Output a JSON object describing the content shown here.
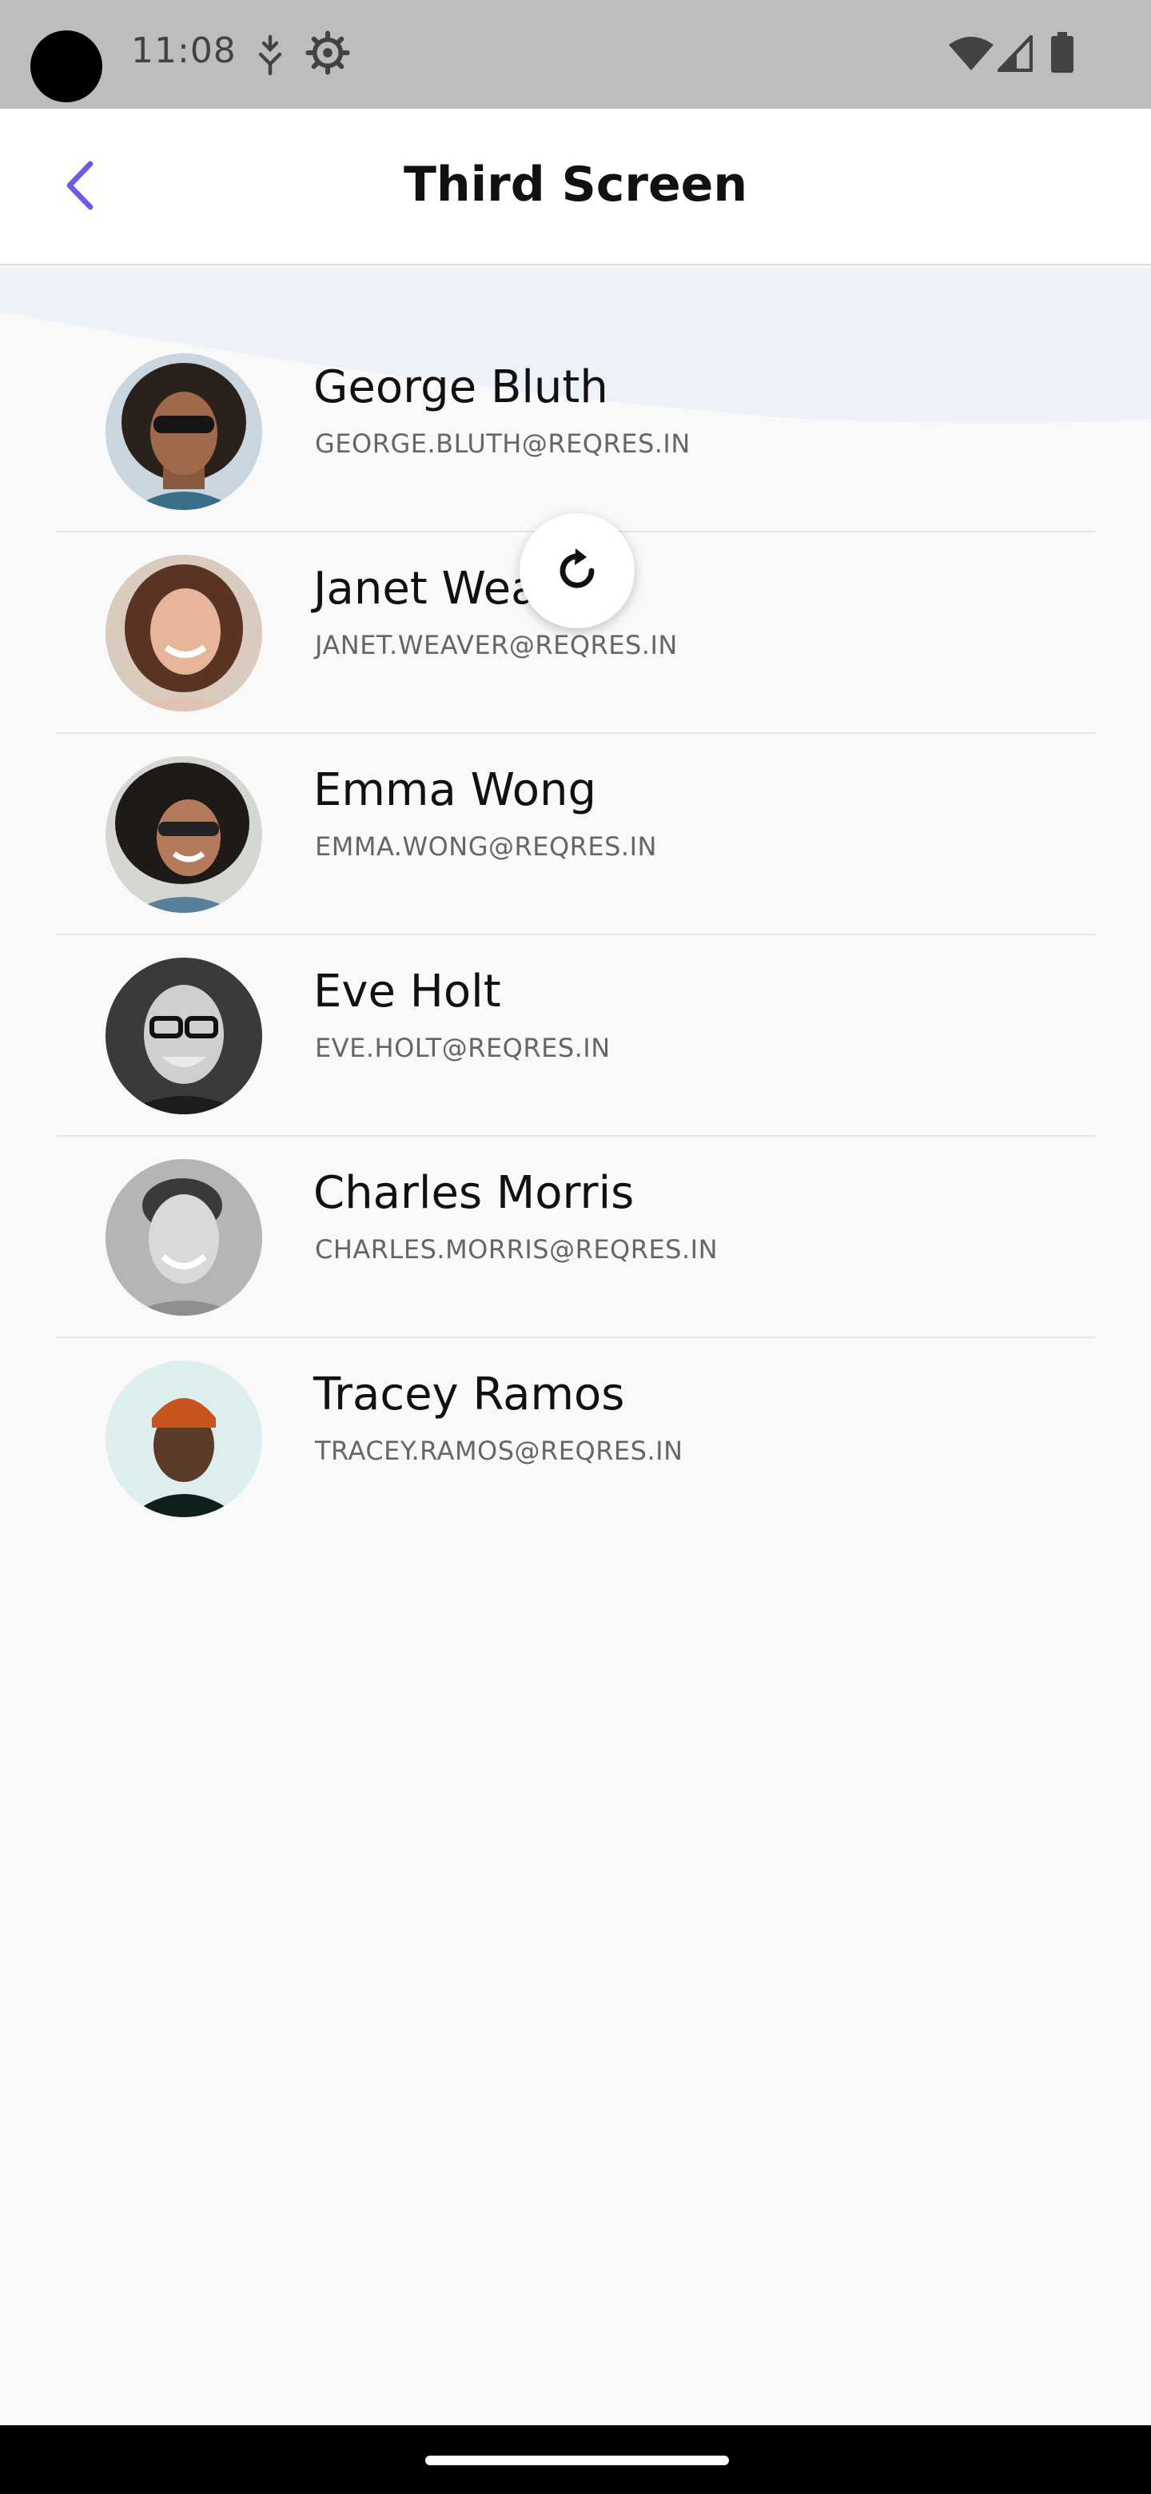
{
  "status_bar": {
    "time": "11:08",
    "icons": [
      "data-saver-icon",
      "settings-gear-icon",
      "wifi-icon",
      "cell-signal-icon",
      "battery-icon"
    ]
  },
  "app_bar": {
    "title": "Third Screen",
    "back_icon": "chevron-left-icon",
    "accent_color": "#6b5ce7"
  },
  "users": [
    {
      "name": "George Bluth",
      "email": "GEORGE.BLUTH@REQRES.IN"
    },
    {
      "name": "Janet Weaver",
      "email": "JANET.WEAVER@REQRES.IN"
    },
    {
      "name": "Emma Wong",
      "email": "EMMA.WONG@REQRES.IN"
    },
    {
      "name": "Eve Holt",
      "email": "EVE.HOLT@REQRES.IN"
    },
    {
      "name": "Charles Morris",
      "email": "CHARLES.MORRIS@REQRES.IN"
    },
    {
      "name": "Tracey Ramos",
      "email": "TRACEY.RAMOS@REQRES.IN"
    }
  ],
  "refresh": {
    "icon": "refresh-icon"
  }
}
